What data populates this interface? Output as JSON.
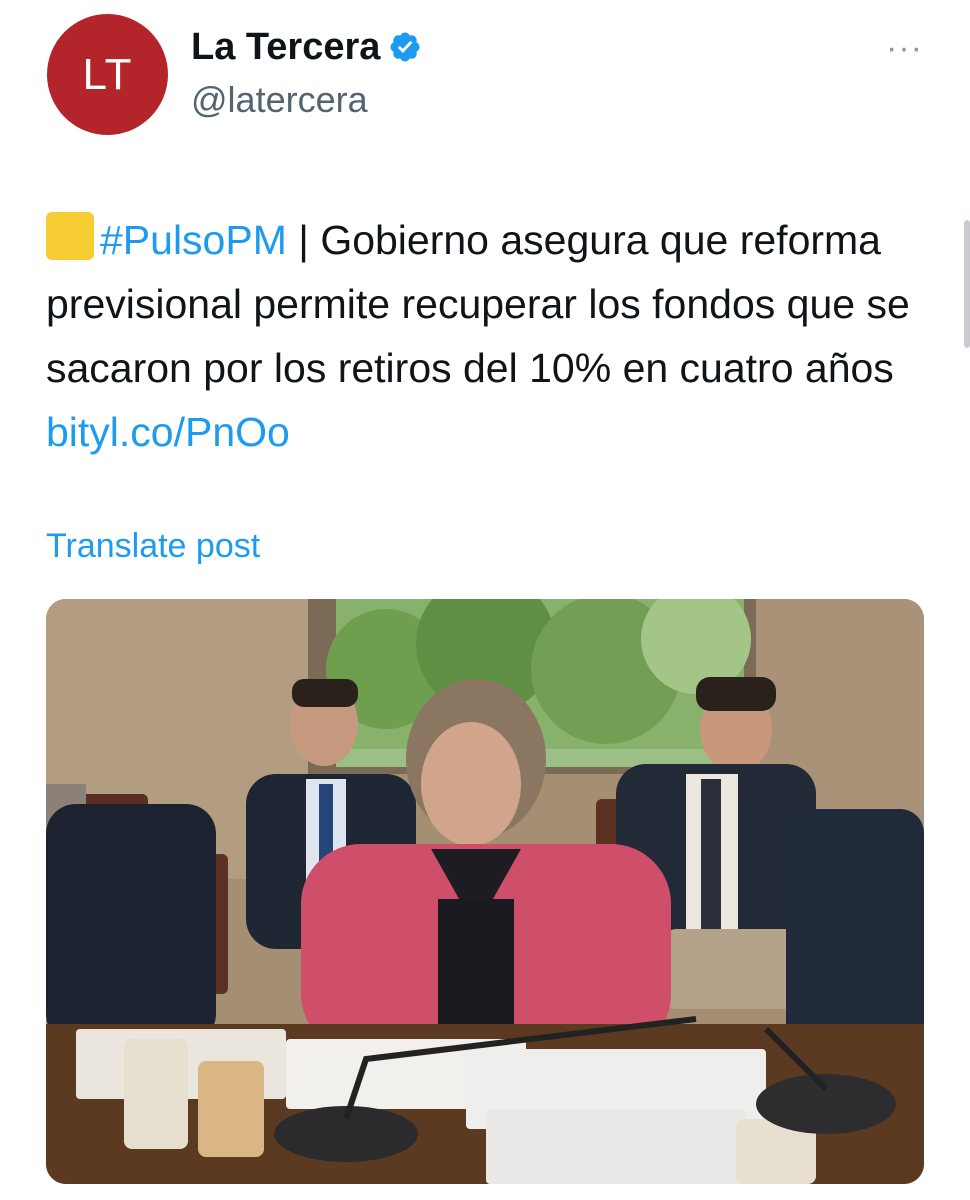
{
  "author": {
    "avatar_text": "LT",
    "display_name": "La Tercera",
    "handle": "@latercera",
    "verified_icon": "verified-badge-icon"
  },
  "menu": {
    "more_label": "···"
  },
  "post": {
    "hashtag": "#PulsoPM",
    "separator": " | ",
    "text": "Gobierno asegura que reforma previsional permite recuperar los fondos que se sacaron por los retiros del 10% en cuatro años",
    "link": "bityl.co/PnOo",
    "emoji": "yellow-square"
  },
  "translate_label": "Translate post",
  "media": {
    "description_icon": "photo"
  },
  "colors": {
    "accent": "#1d9bf0",
    "avatar_bg": "#b4242b",
    "text": "#0f1419",
    "secondary": "#536471"
  }
}
